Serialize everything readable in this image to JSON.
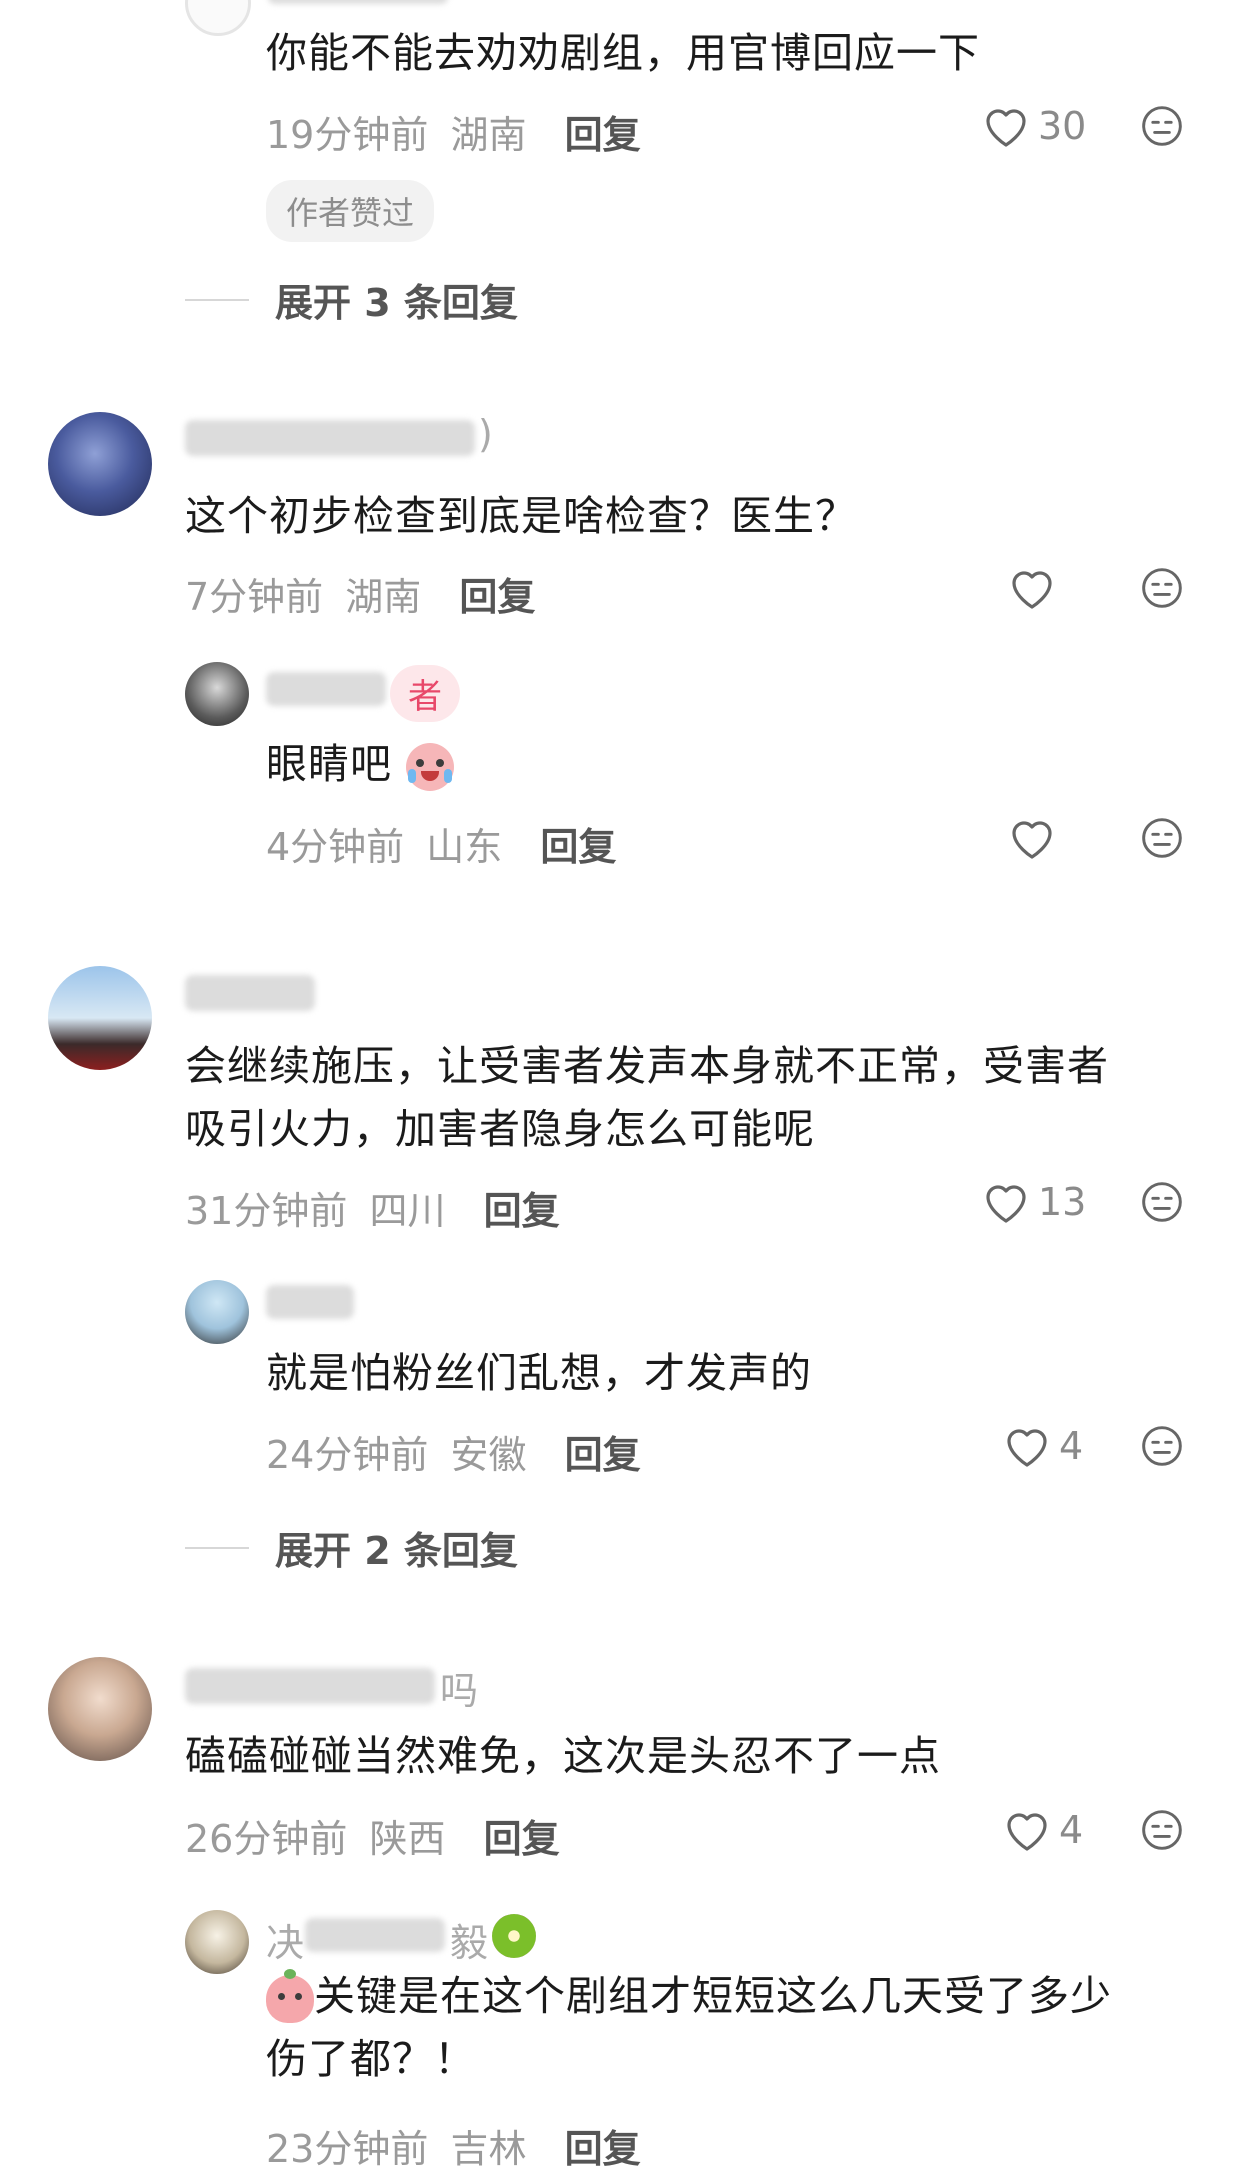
{
  "thread1": {
    "reply_text": "你能不能去劝劝剧组，用官博回应一下",
    "time": "19分钟前",
    "location": "湖南",
    "reply_label": "回复",
    "likes": "30",
    "author_liked": "作者赞过",
    "expand_label": "展开 3 条回复"
  },
  "thread2": {
    "name_tail": ")",
    "text": "这个初步检查到底是啥检查？医生？",
    "time": "7分钟前",
    "location": "湖南",
    "reply_label": "回复",
    "reply": {
      "badge": "者",
      "text": "眼睛吧",
      "time": "4分钟前",
      "location": "山东",
      "reply_label": "回复"
    }
  },
  "thread3": {
    "text_line1": "会继续施压，让受害者发声本身就不正常，受害者",
    "text_line2": "吸引火力，加害者隐身怎么可能呢",
    "time": "31分钟前",
    "location": "四川",
    "reply_label": "回复",
    "likes": "13",
    "reply": {
      "text": "就是怕粉丝们乱想，才发声的",
      "time": "24分钟前",
      "location": "安徽",
      "reply_label": "回复",
      "likes": "4"
    },
    "expand_label": "展开 2 条回复"
  },
  "thread4": {
    "name_tail": "吗",
    "text": "磕磕碰碰当然难免，这次是头忍不了一点",
    "time": "26分钟前",
    "location": "陕西",
    "reply_label": "回复",
    "likes": "4",
    "reply": {
      "name_head": "决",
      "name_tail": "毅",
      "text_line1": "关键是在这个剧组才短短这么几天受了多少",
      "text_line2": "伤了都？！",
      "time": "23分钟前",
      "location": "吉林",
      "reply_label": "回复"
    }
  },
  "colors": {
    "accent_pink": "#e8486a",
    "meta_gray": "#9a9a9a"
  }
}
